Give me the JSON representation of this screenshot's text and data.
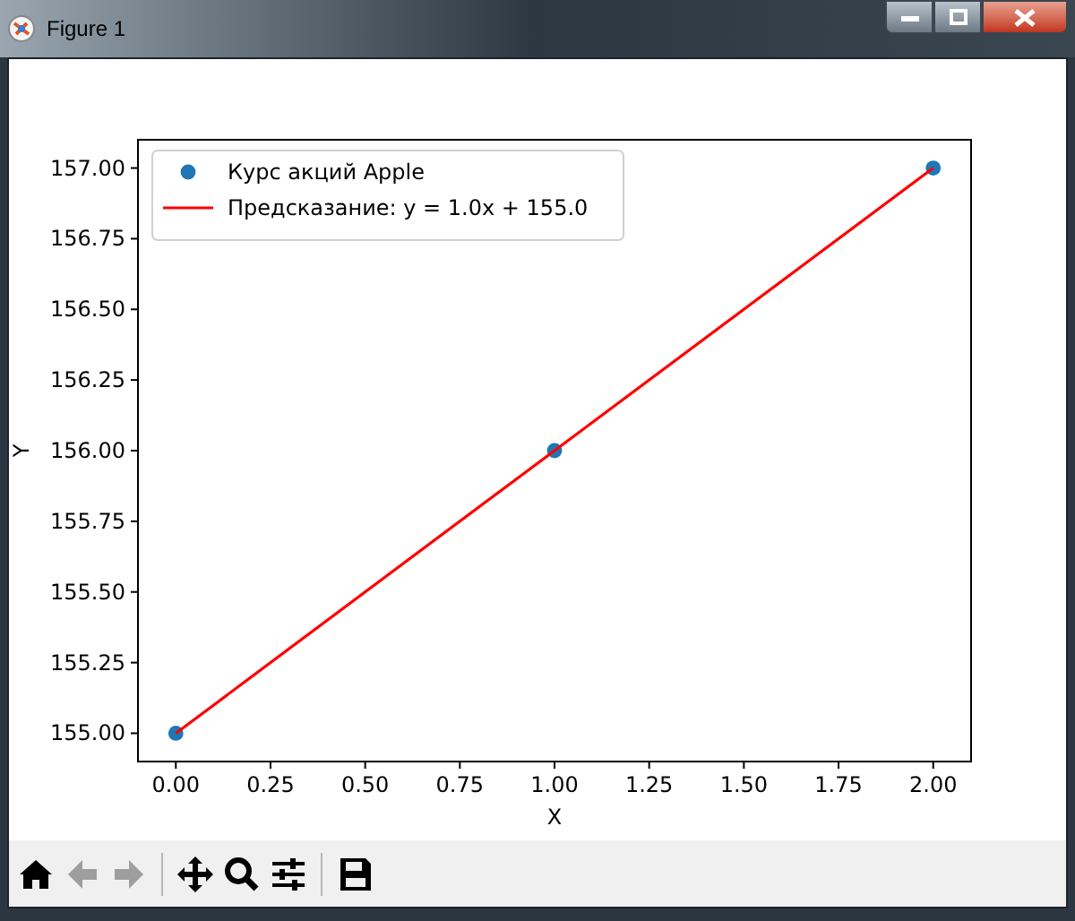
{
  "window": {
    "title": "Figure 1"
  },
  "figure": {
    "chart_data": {
      "type": "scatter",
      "xlabel": "X",
      "ylabel": "Y",
      "xlim": [
        -0.1,
        2.1
      ],
      "ylim": [
        154.9,
        157.1
      ],
      "xticks": [
        {
          "value": 0,
          "label": "0.00"
        },
        {
          "value": 0.25,
          "label": "0.25"
        },
        {
          "value": 0.5,
          "label": "0.50"
        },
        {
          "value": 0.75,
          "label": "0.75"
        },
        {
          "value": 1,
          "label": "1.00"
        },
        {
          "value": 1.25,
          "label": "1.25"
        },
        {
          "value": 1.5,
          "label": "1.50"
        },
        {
          "value": 1.75,
          "label": "1.75"
        },
        {
          "value": 2,
          "label": "2.00"
        }
      ],
      "yticks": [
        {
          "value": 155,
          "label": "155.00"
        },
        {
          "value": 155.25,
          "label": "155.25"
        },
        {
          "value": 155.5,
          "label": "155.50"
        },
        {
          "value": 155.75,
          "label": "155.75"
        },
        {
          "value": 156,
          "label": "156.00"
        },
        {
          "value": 156.25,
          "label": "156.25"
        },
        {
          "value": 156.5,
          "label": "156.50"
        },
        {
          "value": 156.75,
          "label": "156.75"
        },
        {
          "value": 157,
          "label": "157.00"
        }
      ],
      "x": [
        0,
        1,
        2
      ],
      "legend": true,
      "series": [
        {
          "name": "Курс акций Apple",
          "color": "#1f77b4",
          "values": [
            155,
            156,
            157
          ]
        },
        {
          "name": "Предсказание: y = 1.0x + 155.0",
          "type": "line",
          "color": "#ff0000",
          "values": [
            155,
            156,
            157
          ]
        }
      ]
    }
  },
  "toolbar": {
    "buttons": [
      {
        "kind": "home",
        "disabled": false
      },
      {
        "kind": "back",
        "disabled": true
      },
      {
        "kind": "forward",
        "disabled": true
      },
      {
        "kind": "separator"
      },
      {
        "kind": "move",
        "disabled": false
      },
      {
        "kind": "zoom",
        "disabled": false
      },
      {
        "kind": "configure",
        "disabled": false
      },
      {
        "kind": "separator"
      },
      {
        "kind": "save",
        "disabled": false
      }
    ]
  }
}
